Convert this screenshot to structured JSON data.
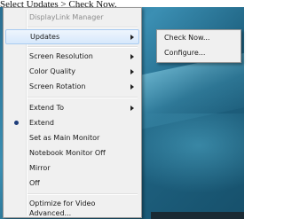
{
  "caption": "Select Updates > Check Now.",
  "menu": {
    "header": "DisplayLink Manager",
    "items": [
      {
        "label": "Updates",
        "has_submenu": true
      },
      {
        "label": "Screen Resolution",
        "has_submenu": true
      },
      {
        "label": "Color Quality",
        "has_submenu": true
      },
      {
        "label": "Screen Rotation",
        "has_submenu": true
      },
      {
        "label": "Extend To",
        "has_submenu": true
      },
      {
        "label": "Extend",
        "selected": true
      },
      {
        "label": "Set as Main Monitor"
      },
      {
        "label": "Notebook Monitor Off"
      },
      {
        "label": "Mirror"
      },
      {
        "label": "Off"
      },
      {
        "label": "Optimize for Video"
      },
      {
        "label": "Advanced..."
      }
    ]
  },
  "submenu": {
    "items": [
      {
        "label": "Check Now..."
      },
      {
        "label": "Configure..."
      }
    ]
  }
}
